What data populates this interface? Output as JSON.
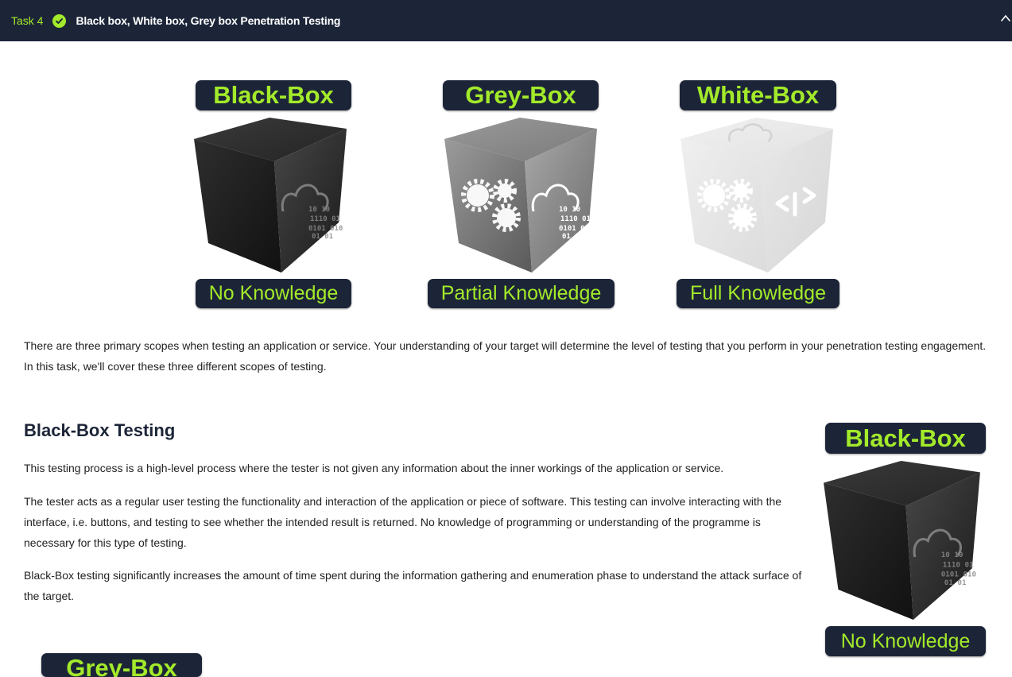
{
  "task": {
    "number_label": "Task 4",
    "title": "Black box, White box, Grey box Penetration Testing",
    "colors": {
      "bar": "#1c2538",
      "accent": "#a3ea2a"
    },
    "icons": {
      "completed": "check-circle-icon",
      "collapse": "chevron-up-icon"
    }
  },
  "hero": {
    "black": {
      "title": "Black-Box",
      "caption": "No Knowledge"
    },
    "grey": {
      "title": "Grey-Box",
      "caption": "Partial Knowledge"
    },
    "white": {
      "title": "White-Box",
      "caption": "Full Knowledge"
    }
  },
  "intro": "There are three primary scopes when testing an application or service. Your understanding of your target will determine the level of testing that you perform in your penetration testing engagement. In this task, we'll cover these three different scopes of testing.",
  "black_section": {
    "heading": "Black-Box Testing",
    "p1": "This testing process is a high-level process where the tester is not given any information about the inner workings of the application or service.",
    "p2": "The tester acts as a regular user testing the functionality and interaction of the application or piece of software. This testing can involve interacting with the interface, i.e. buttons, and testing to see whether the intended result is returned. No knowledge of programming or understanding of the programme is necessary for this type of testing.",
    "p3": "Black-Box testing significantly increases the amount of time spent during the information gathering and enumeration phase to understand the attack surface of the target.",
    "figure": {
      "title": "Black-Box",
      "caption": "No Knowledge"
    }
  },
  "grey_section": {
    "figure_title": "Grey-Box"
  }
}
